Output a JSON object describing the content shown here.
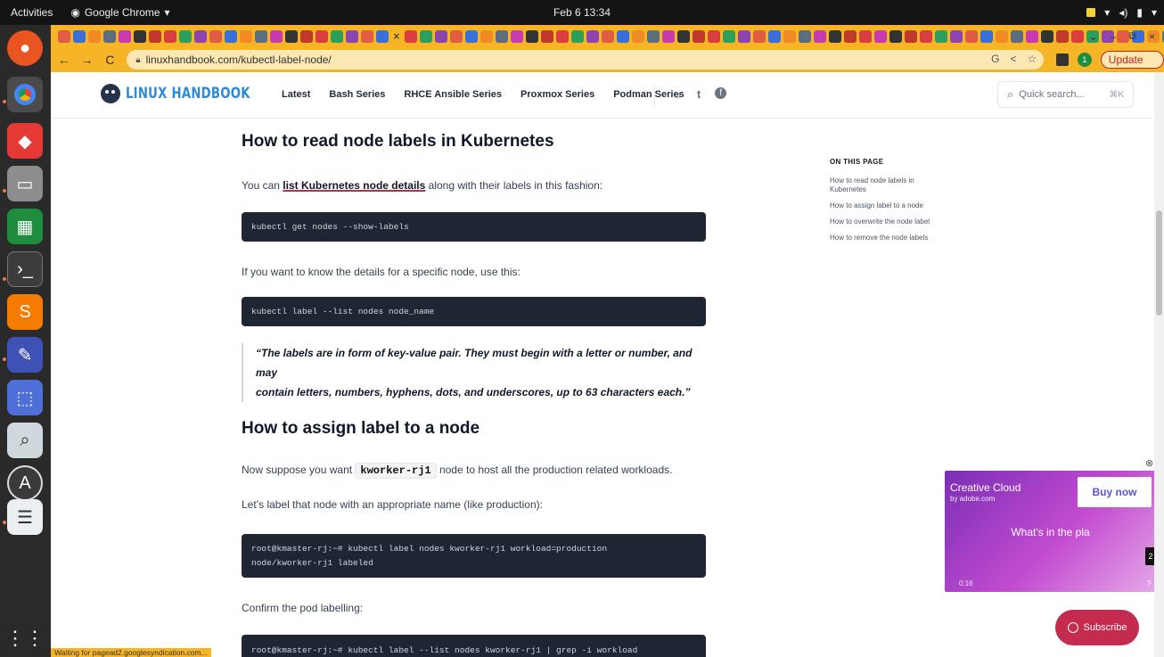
{
  "system": {
    "activities": "Activities",
    "app_name": "Google Chrome",
    "clock": "Feb 6  13:34"
  },
  "browser": {
    "url": "linuxhandbook.com/kubectl-label-node/",
    "update_label": "Update",
    "profile_badge": "1"
  },
  "site": {
    "logo": "LINUX HANDBOOK",
    "nav": [
      "Latest",
      "Bash Series",
      "RHCE Ansible Series",
      "Proxmox Series",
      "Podman Series"
    ],
    "search_placeholder": "Quick search...",
    "search_shortcut": "⌘K"
  },
  "article": {
    "h_read": "How to read node labels in Kubernetes",
    "p_list_prefix": "You can ",
    "p_list_link": "list Kubernetes node details",
    "p_list_suffix": " along with their labels in this fashion:",
    "code_show_labels": "kubectl get nodes --show-labels",
    "p_specific": "If you want to know the details for a specific node, use this:",
    "code_list_node": "kubectl label --list nodes node_name",
    "quote_line1": "“The labels are in form of key-value pair. They must begin with a letter or number, and may",
    "quote_line2": "contain letters, numbers, hyphens, dots, and underscores, up to 63 characters each.”",
    "h_assign": "How to assign label to a node",
    "p_suppose_prefix": "Now suppose you want ",
    "p_suppose_code": "kworker-rj1",
    "p_suppose_suffix": " node to host all the production related workloads.",
    "p_label": "Let’s label that node with an appropriate name (like production):",
    "code_label_line1": "root@kmaster-rj:~# kubectl label nodes kworker-rj1 workload=production",
    "code_label_line2": "node/kworker-rj1 labeled",
    "p_confirm": "Confirm the pod labelling:",
    "code_confirm": "root@kmaster-rj:~# kubectl label --list nodes kworker-rj1 | grep -i workload"
  },
  "toc": {
    "title": "ON THIS PAGE",
    "items": [
      "How to read node labels in Kubernetes",
      "How to assign label to a node",
      "How to overwrite the node label",
      "How to remove the node labels"
    ]
  },
  "ad": {
    "brand": "Creative Cloud",
    "by": "by adobe.com",
    "cta": "Buy now",
    "tagline": "What's in the pla",
    "timer": "0:16",
    "count": "2",
    "close": "⊗",
    "info": "?"
  },
  "subscribe_label": "Subscribe",
  "status_text": "Waiting for pagead2.googlesyndication.com...",
  "colors": {
    "chrome_theme": "#f6b526",
    "brand_blue": "#2f8bd6",
    "accent_red": "#c42b4e",
    "code_bg": "#1e2533"
  }
}
